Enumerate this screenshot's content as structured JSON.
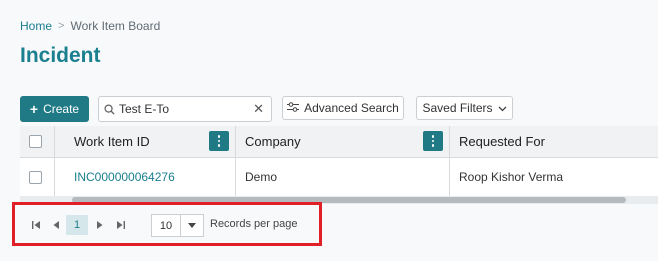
{
  "breadcrumb": {
    "home": "Home",
    "separator": ">",
    "current": "Work Item Board"
  },
  "page": {
    "title": "Incident"
  },
  "toolbar": {
    "create_label": "Create",
    "create_icon": "plus-icon",
    "search_value": "Test E-To",
    "search_icon": "search-icon",
    "clear_icon": "close-icon",
    "advanced_search_label": "Advanced Search",
    "advanced_search_icon": "sliders-icon",
    "saved_filters_label": "Saved Filters",
    "saved_filters_icon": "chevron-down-icon"
  },
  "grid": {
    "columns": [
      "Work Item ID",
      "Company",
      "Requested For"
    ],
    "column_menu_icon": "kebab-menu-icon",
    "rows": [
      {
        "work_item_id": "INC000000064276",
        "company": "Demo",
        "requested_for": "Roop Kishor Verma"
      }
    ]
  },
  "pagination": {
    "current_page": "1",
    "page_size": "10",
    "records_per_page_label": "Records per page"
  },
  "colors": {
    "accent": "#1f7a85",
    "link": "#1a7f8e",
    "highlight_border": "#e01f26"
  }
}
